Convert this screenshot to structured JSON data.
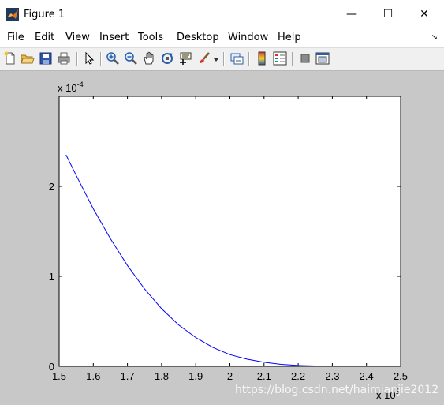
{
  "window": {
    "title": "Figure 1",
    "minimize_glyph": "—",
    "maximize_glyph": "☐",
    "close_glyph": "✕"
  },
  "menu": {
    "items": [
      "File",
      "Edit",
      "View",
      "Insert",
      "Tools",
      "Desktop",
      "Window",
      "Help"
    ],
    "dock_arrow": "↘"
  },
  "toolbar": {
    "buttons": [
      "new-figure-icon",
      "open-file-icon",
      "save-icon",
      "print-icon",
      "edit-plot-arrow-icon",
      "zoom-in-icon",
      "zoom-out-icon",
      "pan-hand-icon",
      "rotate-3d-icon",
      "data-cursor-icon",
      "brush-icon",
      "link-plot-icon",
      "colorbar-icon",
      "legend-icon",
      "hide-plot-tools-icon",
      "show-plot-tools-icon"
    ]
  },
  "chart_data": {
    "type": "line",
    "x_multiplier": "x 10",
    "x_multiplier_exp": "5",
    "y_multiplier": "x 10",
    "y_multiplier_exp": "-4",
    "xlim": [
      1.5,
      2.5
    ],
    "ylim": [
      0,
      3
    ],
    "xticks": [
      "1.5",
      "1.6",
      "1.7",
      "1.8",
      "1.9",
      "2",
      "2.1",
      "2.2",
      "2.3",
      "2.4",
      "2.5"
    ],
    "yticks": [
      "0",
      "1",
      "2"
    ],
    "series": [
      {
        "color": "#0000ff",
        "x": [
          1.52,
          1.55,
          1.6,
          1.65,
          1.7,
          1.75,
          1.8,
          1.85,
          1.9,
          1.95,
          2.0,
          2.05,
          2.1,
          2.15,
          2.2,
          2.25,
          2.3,
          2.35,
          2.4,
          2.45,
          2.5
        ],
        "y": [
          2.35,
          2.12,
          1.75,
          1.42,
          1.12,
          0.86,
          0.64,
          0.46,
          0.32,
          0.21,
          0.13,
          0.08,
          0.045,
          0.022,
          0.01,
          0.004,
          0.0015,
          0.0005,
          0.0001,
          0.0,
          0.0
        ]
      }
    ]
  },
  "watermark": "https://blog.csdn.net/haimianjie2012"
}
